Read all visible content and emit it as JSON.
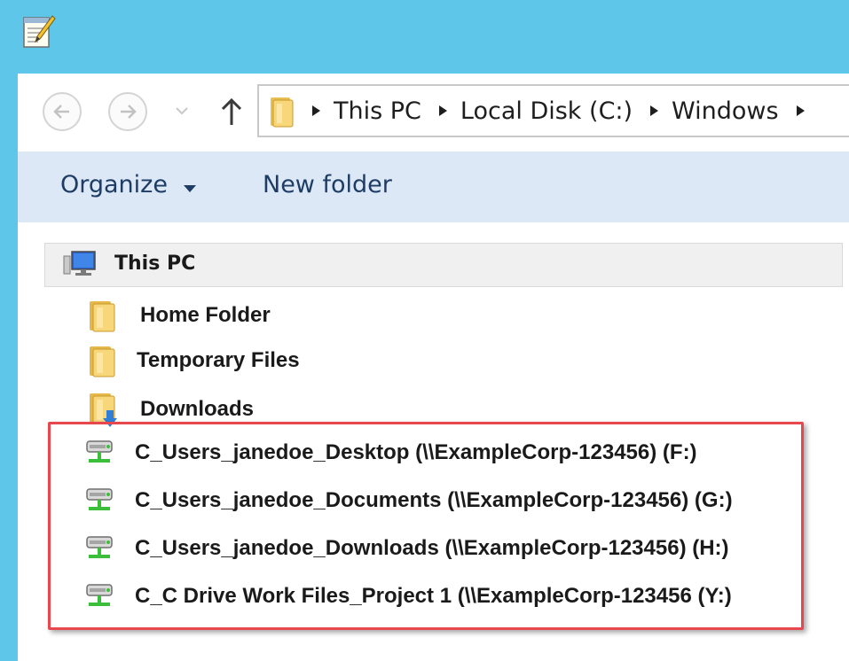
{
  "window": {
    "title_icon": "notepad-app-icon",
    "accent_color": "#5ec6e8"
  },
  "navigation": {
    "back_icon": "back-arrow-icon",
    "forward_icon": "forward-arrow-icon",
    "recent_icon": "chevron-down-icon",
    "up_icon": "up-arrow-icon",
    "breadcrumbs": [
      "This PC",
      "Local Disk (C:)",
      "Windows"
    ]
  },
  "commandbar": {
    "organize_label": "Organize",
    "new_folder_label": "New folder"
  },
  "tree": {
    "root_label": "This PC",
    "folders": [
      {
        "label": "Home Folder",
        "icon": "folder-icon"
      },
      {
        "label": "Temporary Files",
        "icon": "folder-icon"
      },
      {
        "label": "Downloads",
        "icon": "downloads-folder-icon"
      }
    ],
    "network_drives": [
      {
        "label": "C_Users_janedoe_Desktop (\\\\ExampleCorp-123456) (F:)",
        "icon": "network-drive-icon"
      },
      {
        "label": "C_Users_janedoe_Documents (\\\\ExampleCorp-123456) (G:)",
        "icon": "network-drive-icon"
      },
      {
        "label": "C_Users_janedoe_Downloads (\\\\ExampleCorp-123456) (H:)",
        "icon": "network-drive-icon"
      },
      {
        "label": "C_C Drive Work Files_Project 1 (\\\\ExampleCorp-123456 (Y:)",
        "icon": "network-drive-icon"
      }
    ]
  },
  "highlight_color": "#e8474e"
}
